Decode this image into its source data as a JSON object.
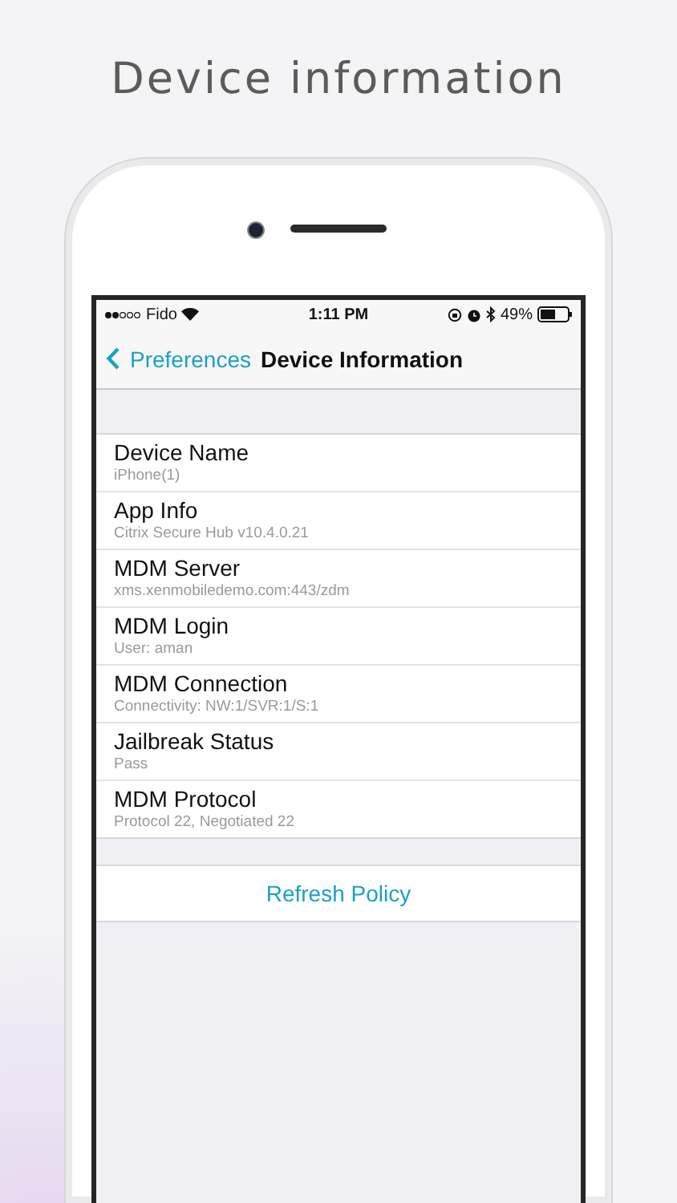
{
  "headline": "Device information",
  "status_bar": {
    "carrier": "Fido",
    "time": "1:11 PM",
    "battery": "49%"
  },
  "nav": {
    "back": "Preferences",
    "title": "Device Information"
  },
  "rows": [
    {
      "label": "Device Name",
      "value": "iPhone(1)"
    },
    {
      "label": "App Info",
      "value": "Citrix Secure Hub v10.4.0.21"
    },
    {
      "label": "MDM Server",
      "value": "xms.xenmobiledemo.com:443/zdm"
    },
    {
      "label": "MDM Login",
      "value": "User: aman"
    },
    {
      "label": "MDM Connection",
      "value": "Connectivity: NW:1/SVR:1/S:1"
    },
    {
      "label": "Jailbreak Status",
      "value": "Pass"
    },
    {
      "label": "MDM Protocol",
      "value": "Protocol 22, Negotiated 22"
    }
  ],
  "action": "Refresh Policy"
}
